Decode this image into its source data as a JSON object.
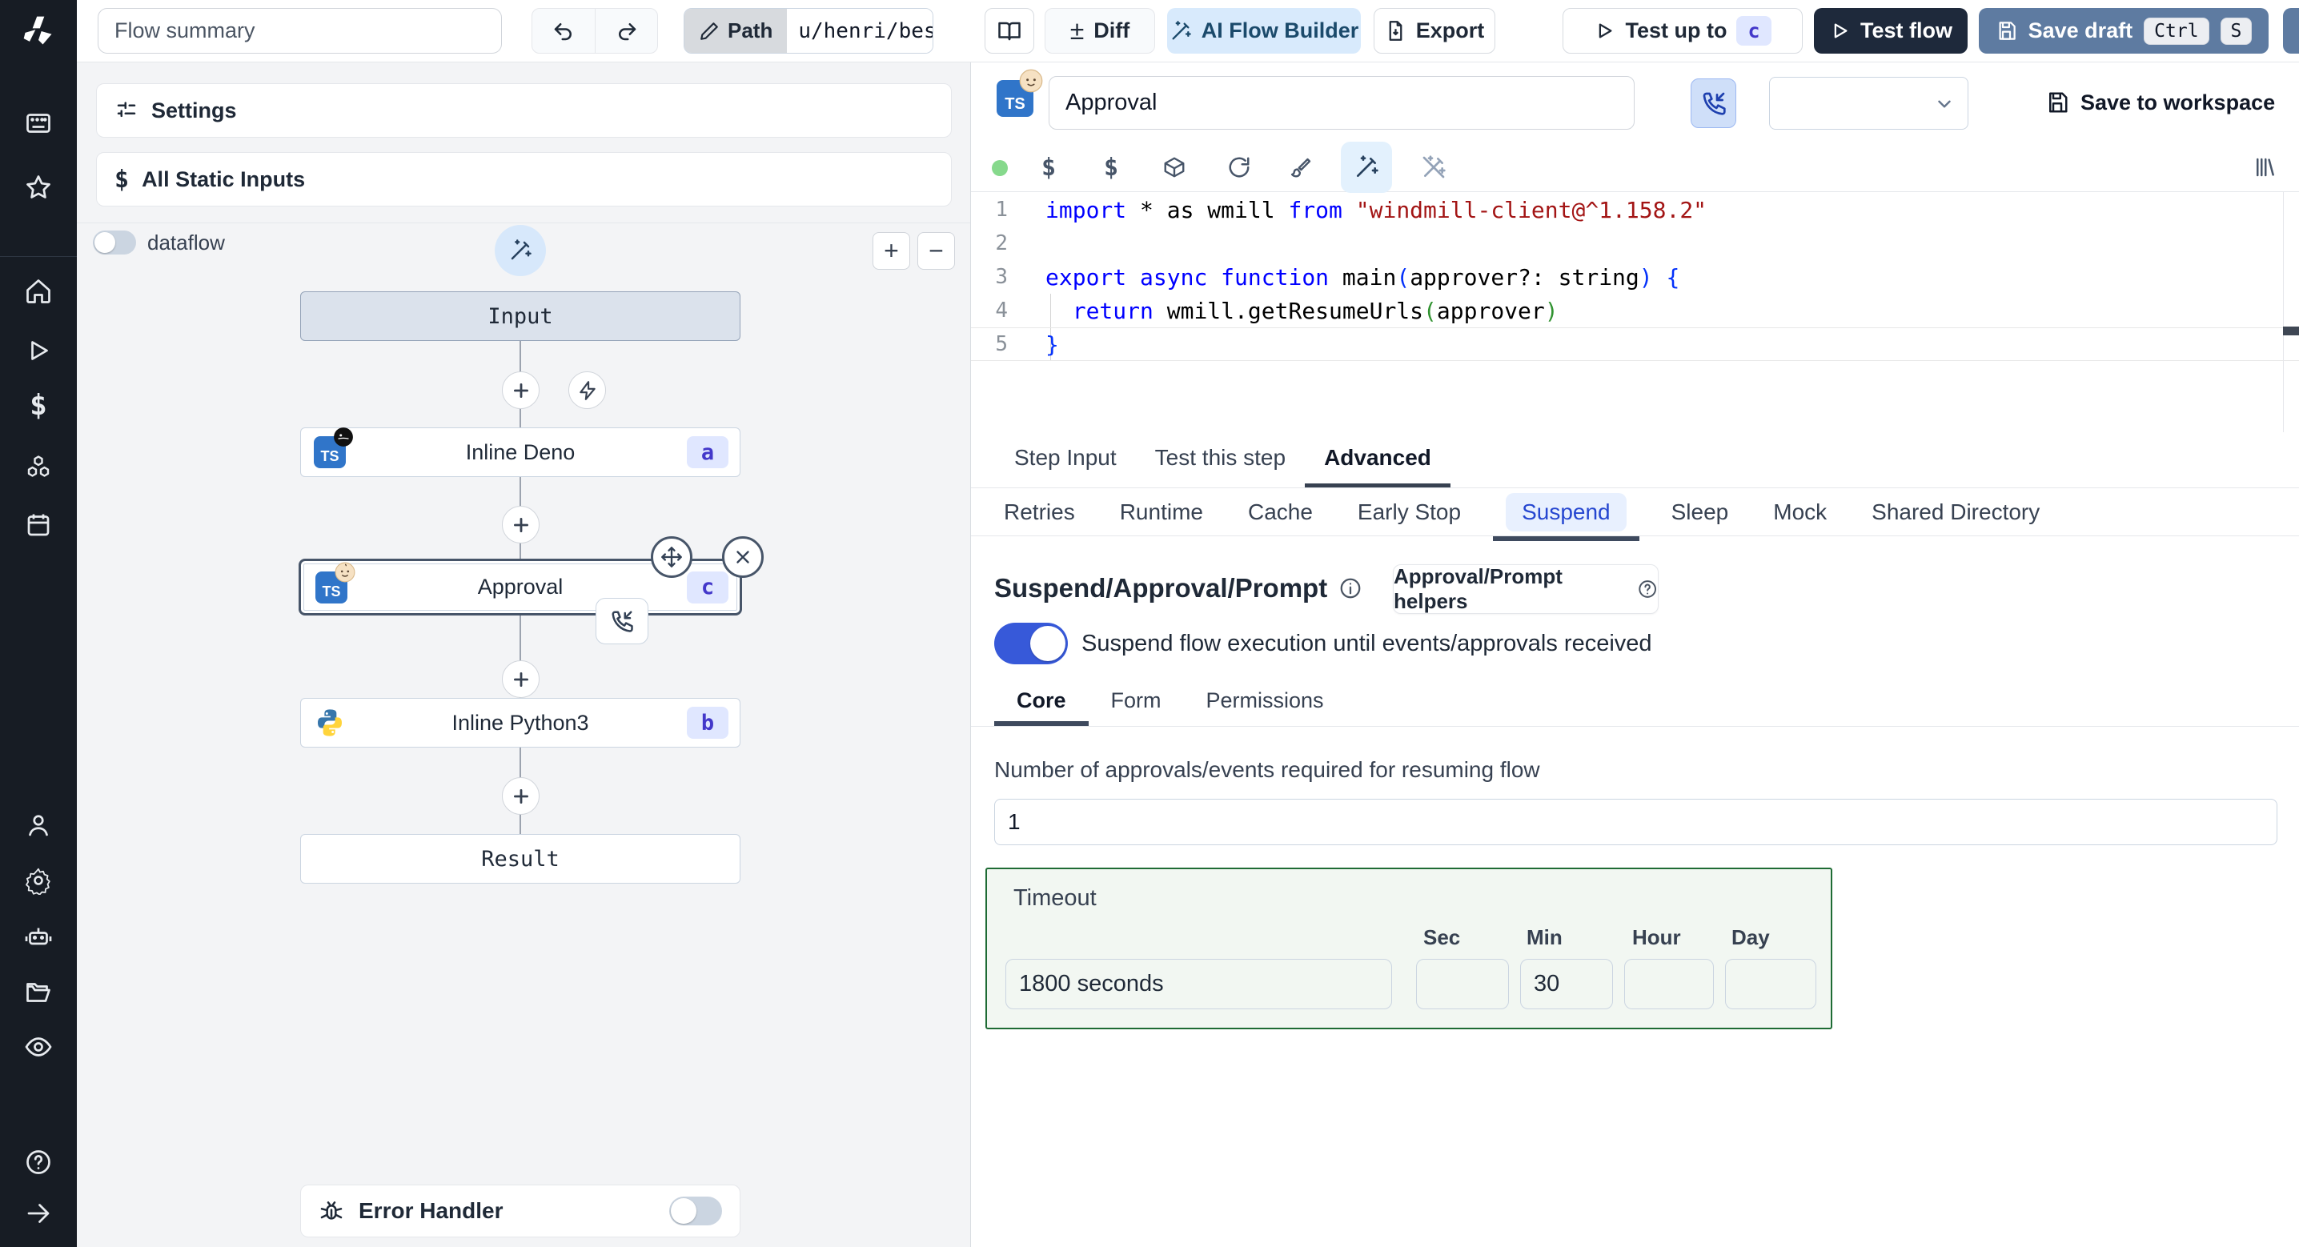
{
  "colors": {
    "sidebar_bg": "#171c24",
    "accent_blue": "#2546d0",
    "toggle_blue": "#3759d9",
    "timeout_green": "#1e6b34",
    "badge_bg": "#e0e7ff",
    "badge_text": "#4338ca",
    "test_flow_bg": "#1e293b",
    "save_draft_bg": "#5e7ba1",
    "ai_builder_bg": "#d8eafc",
    "ai_builder_text": "#1b4a6b",
    "status_dot_green": "#86d98c"
  },
  "sidebar": {
    "icons_top": [
      "apps",
      "star"
    ],
    "icons_mid": [
      "home",
      "runs",
      "variables",
      "resources",
      "schedules"
    ],
    "icons_lower": [
      "user",
      "settings",
      "workers",
      "folders",
      "audit"
    ],
    "icons_footer": [
      "help",
      "collapse"
    ]
  },
  "topbar": {
    "flow_summary_placeholder": "Flow summary",
    "path_label": "Path",
    "path_value": "u/henri/bes",
    "diff_label": "Diff",
    "ai_flow_builder_label": "AI Flow Builder",
    "export_label": "Export",
    "test_up_to_label": "Test up to",
    "test_up_to_badge": "c",
    "test_flow_label": "Test flow",
    "save_draft_label": "Save draft",
    "save_draft_keys": [
      "Ctrl",
      "S"
    ]
  },
  "graph": {
    "settings_label": "Settings",
    "static_inputs_label": "All Static Inputs",
    "dataflow_label": "dataflow",
    "nodes": {
      "input": {
        "label": "Input"
      },
      "deno": {
        "label": "Inline Deno",
        "badge": "a",
        "lang": "TS"
      },
      "approval": {
        "label": "Approval",
        "badge": "c",
        "lang": "TS"
      },
      "python": {
        "label": "Inline Python3",
        "badge": "b"
      },
      "result": {
        "label": "Result"
      }
    },
    "error_handler_label": "Error Handler"
  },
  "step_editor": {
    "name_value": "Approval",
    "lang_badge": "TS",
    "save_to_workspace_label": "Save to workspace",
    "current_line": 5,
    "code": [
      [
        {
          "t": "import",
          "c": "kw"
        },
        {
          "t": " * as wmill ",
          "c": "pl"
        },
        {
          "t": "from",
          "c": "kw"
        },
        {
          "t": " ",
          "c": "pl"
        },
        {
          "t": "\"windmill-client@^1.158.2\"",
          "c": "str"
        }
      ],
      [],
      [
        {
          "t": "export",
          "c": "kw"
        },
        {
          "t": " ",
          "c": "pl"
        },
        {
          "t": "async",
          "c": "kw"
        },
        {
          "t": " ",
          "c": "pl"
        },
        {
          "t": "function",
          "c": "kw"
        },
        {
          "t": " main",
          "c": "pl"
        },
        {
          "t": "(",
          "c": "b1"
        },
        {
          "t": "approver?: string",
          "c": "pl"
        },
        {
          "t": ")",
          "c": "b1"
        },
        {
          "t": " ",
          "c": "pl"
        },
        {
          "t": "{",
          "c": "b1"
        }
      ],
      [
        {
          "t": "  ",
          "c": "pl"
        },
        {
          "t": "return",
          "c": "kw"
        },
        {
          "t": " wmill.getResumeUrls",
          "c": "pl"
        },
        {
          "t": "(",
          "c": "b2"
        },
        {
          "t": "approver",
          "c": "pl"
        },
        {
          "t": ")",
          "c": "b2"
        }
      ],
      [
        {
          "t": "}",
          "c": "b1"
        }
      ]
    ]
  },
  "tabs": {
    "step": [
      {
        "label": "Step Input"
      },
      {
        "label": "Test this step"
      },
      {
        "label": "Advanced",
        "active": true
      }
    ],
    "advanced": [
      {
        "label": "Retries"
      },
      {
        "label": "Runtime"
      },
      {
        "label": "Cache"
      },
      {
        "label": "Early Stop"
      },
      {
        "label": "Suspend",
        "active": true
      },
      {
        "label": "Sleep"
      },
      {
        "label": "Mock"
      },
      {
        "label": "Shared Directory"
      }
    ],
    "suspend_sub": [
      {
        "label": "Core",
        "active": true
      },
      {
        "label": "Form"
      },
      {
        "label": "Permissions"
      }
    ]
  },
  "suspend": {
    "title": "Suspend/Approval/Prompt",
    "helpers_button_label": "Approval/Prompt helpers",
    "toggle_label": "Suspend flow execution until events/approvals received",
    "toggle_on": true,
    "approvals_label": "Number of approvals/events required for resuming flow",
    "approvals_value": "1",
    "timeout": {
      "label": "Timeout",
      "duration_value": "1800 seconds",
      "fields": [
        {
          "label": "Sec",
          "value": ""
        },
        {
          "label": "Min",
          "value": "30"
        },
        {
          "label": "Hour",
          "value": ""
        },
        {
          "label": "Day",
          "value": ""
        }
      ]
    }
  }
}
